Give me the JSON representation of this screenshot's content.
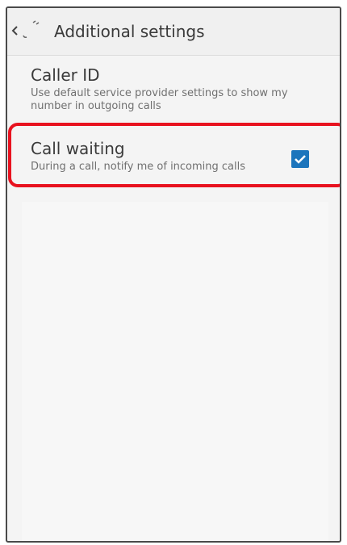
{
  "header": {
    "title": "Additional settings",
    "back_icon": "chevron-left-icon",
    "app_icon": "phone-settings-icon"
  },
  "settings": {
    "caller_id": {
      "title": "Caller ID",
      "summary": "Use default service provider settings to show my number in outgoing calls"
    },
    "call_waiting": {
      "title": "Call waiting",
      "summary": "During a call, notify me of incoming calls",
      "checked": true
    }
  },
  "colors": {
    "checkbox_accent": "#1c75bc",
    "highlight": "#e8121f"
  }
}
